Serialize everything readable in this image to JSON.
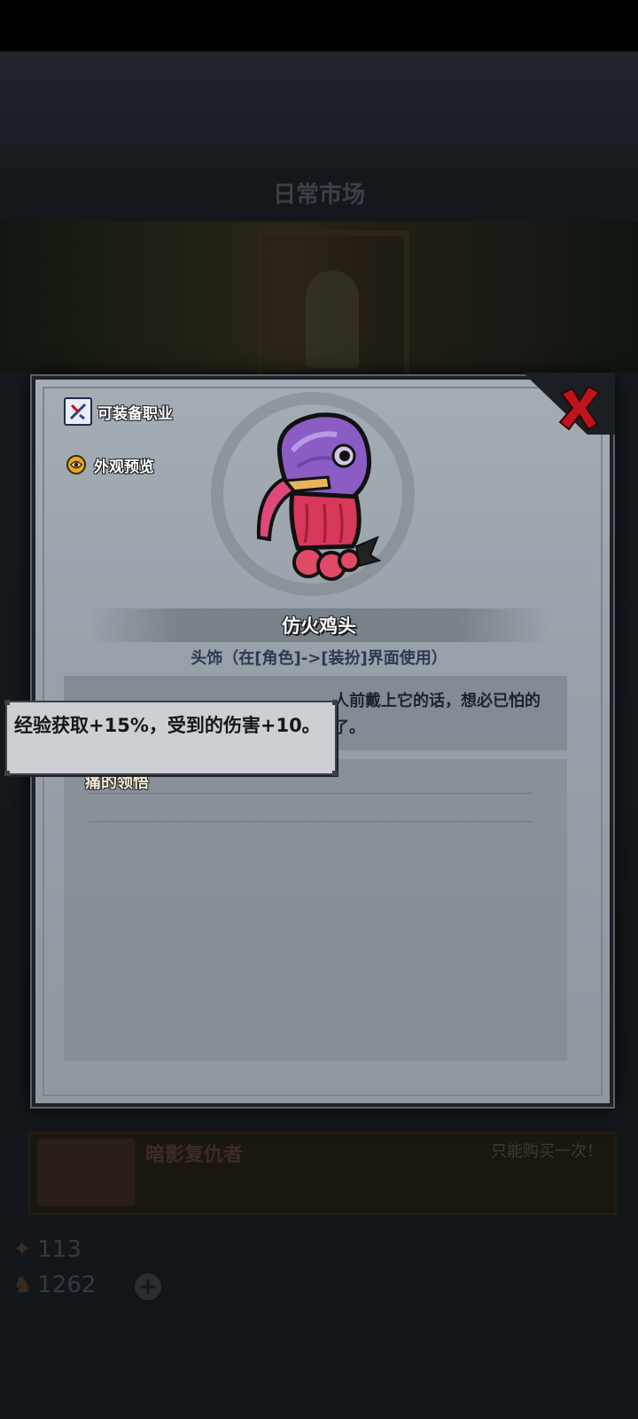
{
  "background": {
    "market_title": "日常市场",
    "shop_item_title": "暗影复仇者",
    "shop_item_note": "只能购买一次！",
    "stat_1": "113",
    "stat_2": "1262"
  },
  "dialog": {
    "close_icon": "close-x-icon",
    "side_links": [
      {
        "label": "可装备职业",
        "icon": "class-icon"
      },
      {
        "label": "外观预览",
        "icon": "preview-icon"
      }
    ],
    "item_name": "仿火鸡头",
    "item_type": "头饰（在[角色]->[装扮]界面使用）",
    "description": "人前戴上它的话，想必已怕的了。",
    "effect_name": "痛的领悟",
    "accent_colors": {
      "close": "#c0141b",
      "name_text": "#ffffff",
      "effect_text": "#f0ead0"
    }
  },
  "tooltip": {
    "text": "经验获取+15%，受到的伤害+10。"
  }
}
